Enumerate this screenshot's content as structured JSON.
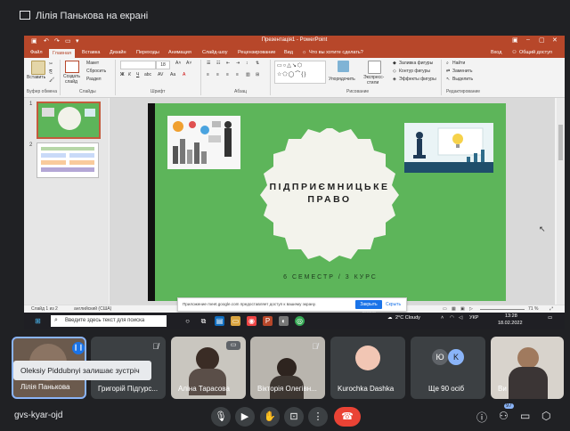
{
  "meet": {
    "presenter_title": "Лілія Панькова на екрані",
    "meeting_code": "gvs-kyar-ojd",
    "toast": "Oleksiy Piddubnyi залишає зустріч",
    "participants": [
      {
        "name": "Лілія Панькова"
      },
      {
        "name": "Григорій Підгурс..."
      },
      {
        "name": "Аліна Тарасова"
      },
      {
        "name": "Вікторія Олегівн..."
      },
      {
        "name": "Kurochka Dashka"
      },
      {
        "name": "Ще 90 осіб",
        "avatar_letters": [
          "Ю",
          "K"
        ]
      },
      {
        "name": "Ви"
      }
    ],
    "people_badge": "97"
  },
  "ppt": {
    "title": "Презентація1 - PowerPoint",
    "tabs": [
      "Файл",
      "Главная",
      "Вставка",
      "Дизайн",
      "Переходы",
      "Анимация",
      "Слайд-шоу",
      "Рецензирование",
      "Вид"
    ],
    "tell_me": "Что вы хотите сделать?",
    "sign_in": "Вход",
    "share": "Общий доступ",
    "ribbon": {
      "paste": "Вставить",
      "cut": "Макет",
      "reset": "Сбросить",
      "section": "Раздел",
      "new_slide_l1": "Создать",
      "new_slide_l2": "слайд",
      "arrange": "Упорядочить",
      "quick_styles_l1": "Экспресс-",
      "quick_styles_l2": "стили",
      "fill": "Заливка фигуры",
      "outline": "Контур фигуры",
      "effects": "Эффекты фигуры",
      "find": "Найти",
      "replace": "Заменить",
      "select": "Выделить",
      "font_size": "18",
      "groups": {
        "clipboard": "Буфер обмена",
        "slides": "Слайды",
        "font": "Шрифт",
        "paragraph": "Абзац",
        "drawing": "Рисование",
        "editing": "Редактирование"
      }
    },
    "thumbs": [
      {
        "num": "1"
      },
      {
        "num": "2"
      }
    ],
    "slide": {
      "title_line1": "ПІДПРИЄМНИЦЬКЕ",
      "title_line2": "ПРАВО",
      "subtitle": "6 СЕМЕСТР / 3 КУРС"
    },
    "status": {
      "slide_of": "Слайд 1 из 2",
      "language": "английский (США)",
      "zoom": "71 %"
    }
  },
  "notification": {
    "text": "Приложение meet.google.com предоставляет доступ к вашему экрану.",
    "stop": "Закрыть доступ",
    "hide": "Скрыть"
  },
  "taskbar": {
    "search_placeholder": "Введите здесь текст для поиска",
    "weather": "2°C  Cloudy",
    "lang": "УКР",
    "time": "13:28",
    "date": "18.02.2022"
  },
  "colors": {
    "ppt_accent": "#b7472a",
    "slide_bg": "#5db55a",
    "meet_bg": "#202124",
    "hangup": "#ea4335"
  }
}
